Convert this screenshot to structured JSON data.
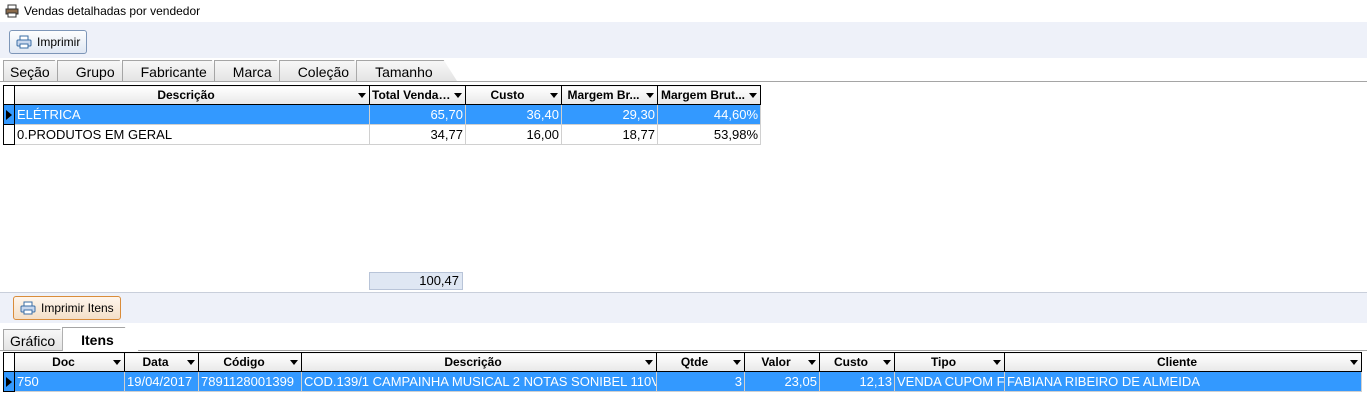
{
  "window": {
    "title": "Vendas detalhadas por vendedor",
    "icon": "printer-app-icon"
  },
  "toolbar": {
    "print_label": "Imprimir"
  },
  "top_tabs": [
    {
      "label": "Seção",
      "active": false
    },
    {
      "label": "Grupo",
      "active": false
    },
    {
      "label": "Fabricante",
      "active": false
    },
    {
      "label": "Marca",
      "active": false
    },
    {
      "label": "Coleção",
      "active": false
    },
    {
      "label": "Tamanho",
      "active": false
    }
  ],
  "summary_grid": {
    "columns": [
      "Descrição",
      "Total Vendas",
      "Custo",
      "Margem Br...",
      "Margem Brut..."
    ],
    "sort_indicator": "↓",
    "rows": [
      {
        "cells": [
          "ELÉTRICA",
          "65,70",
          "36,40",
          "29,30",
          "44,60%"
        ],
        "selected": true
      },
      {
        "cells": [
          "0.PRODUTOS EM GERAL",
          "34,77",
          "16,00",
          "18,77",
          "53,98%"
        ],
        "selected": false
      }
    ],
    "total": "100,47"
  },
  "items_toolbar": {
    "print_items_label": "Imprimir Itens"
  },
  "bottom_tabs": [
    {
      "label": "Gráfico",
      "active": false
    },
    {
      "label": "Itens",
      "active": true
    }
  ],
  "items_grid": {
    "columns": [
      "Doc",
      "Data",
      "Código",
      "Descrição",
      "Qtde",
      "Valor",
      "Custo",
      "Tipo",
      "Cliente"
    ],
    "rows": [
      {
        "cells": [
          "750",
          "19/04/2017",
          "7891128001399",
          "COD.139/1 CAMPAINHA MUSICAL 2 NOTAS SONIBEL 110V",
          "3",
          "23,05",
          "12,13",
          "VENDA CUPOM F",
          "FABIANA RIBEIRO DE ALMEIDA"
        ],
        "selected": true
      }
    ]
  },
  "colors": {
    "selection": "#3399ff",
    "panel": "#eef1f9"
  }
}
